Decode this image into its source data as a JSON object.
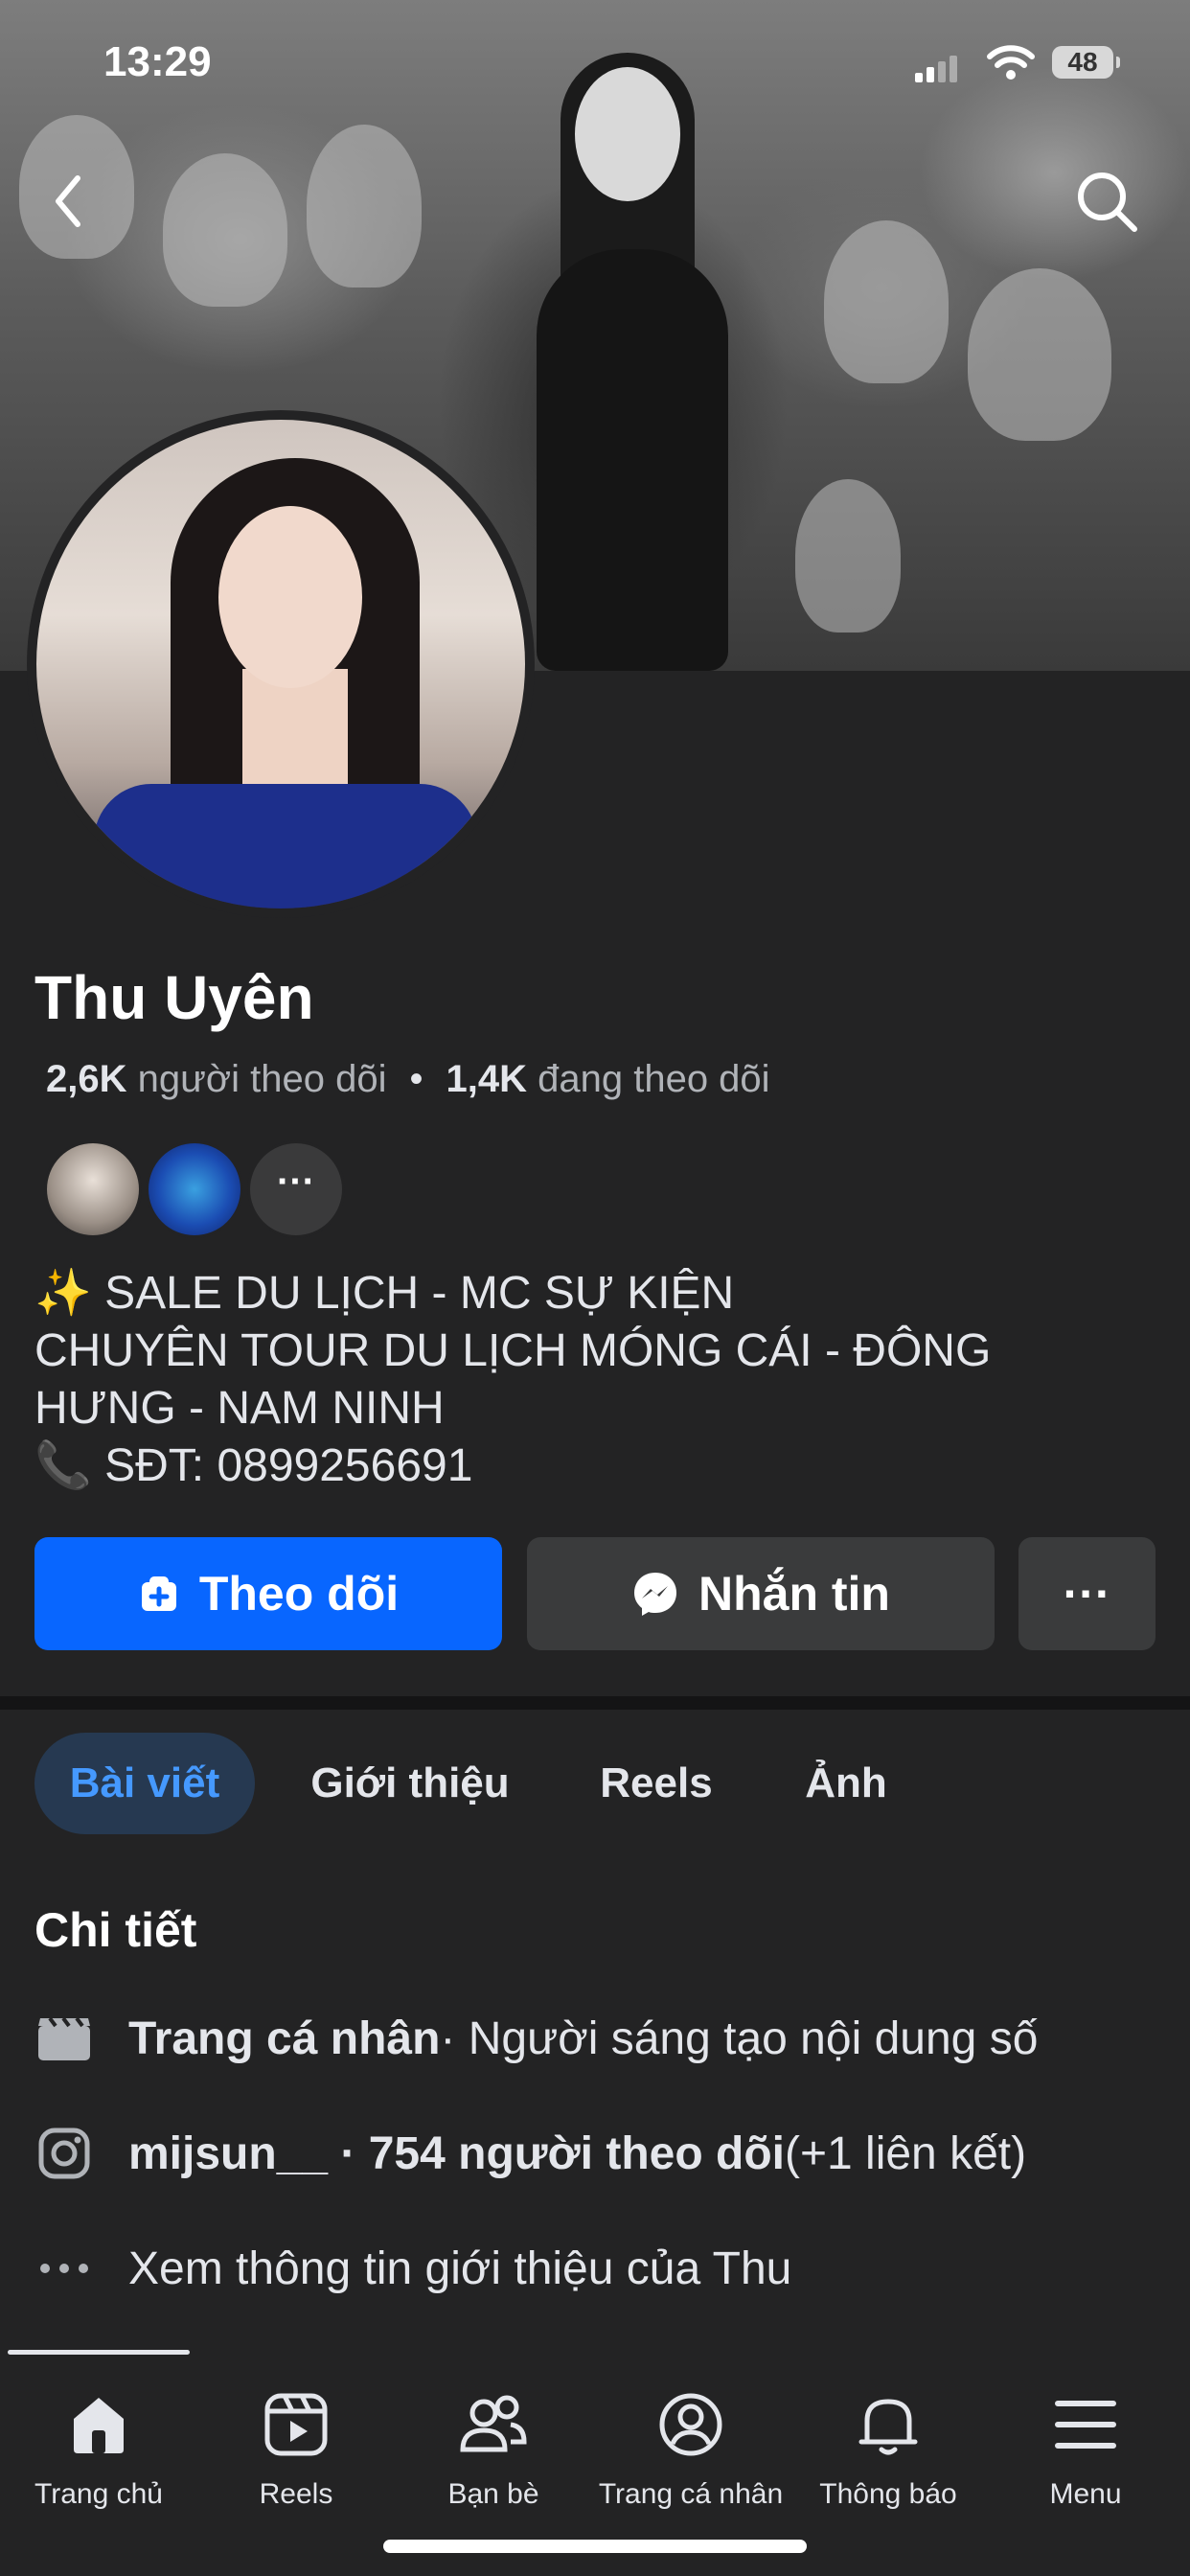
{
  "status_bar": {
    "time": "13:29",
    "battery": "48"
  },
  "profile": {
    "name": "Thu Uyên",
    "followers_count": "2,6K",
    "followers_label": "người theo dõi",
    "following_count": "1,4K",
    "following_label": "đang theo dõi",
    "mutual_more": "···"
  },
  "bio": [
    "✨ SALE DU LỊCH - MC SỰ KIỆN",
    "CHUYÊN TOUR DU LỊCH MÓNG CÁI - ĐÔNG",
    "HƯNG - NAM NINH",
    "📞 SĐT: 0899256691"
  ],
  "actions": {
    "follow": "Theo dõi",
    "message": "Nhắn tin",
    "more": "···"
  },
  "tabs": [
    {
      "label": "Bài viết"
    },
    {
      "label": "Giới thiệu"
    },
    {
      "label": "Reels"
    },
    {
      "label": "Ảnh"
    }
  ],
  "details": {
    "title": "Chi tiết",
    "profile_type_bold": "Trang cá nhân",
    "profile_type_rest": " · Người sáng tạo nội dung số",
    "instagram_bold": "mijsun__ · 754 người theo dõi",
    "instagram_rest": " (+1 liên kết)",
    "see_more": "Xem thông tin giới thiệu của Thu"
  },
  "bottom_nav": [
    {
      "label": "Trang chủ"
    },
    {
      "label": "Reels"
    },
    {
      "label": "Bạn bè"
    },
    {
      "label": "Trang cá nhân"
    },
    {
      "label": "Thông báo"
    },
    {
      "label": "Menu"
    }
  ],
  "colors": {
    "background": "#232324",
    "accent": "#0866ff",
    "active_tab_bg": "#263951",
    "active_tab_text": "#4599ff"
  }
}
